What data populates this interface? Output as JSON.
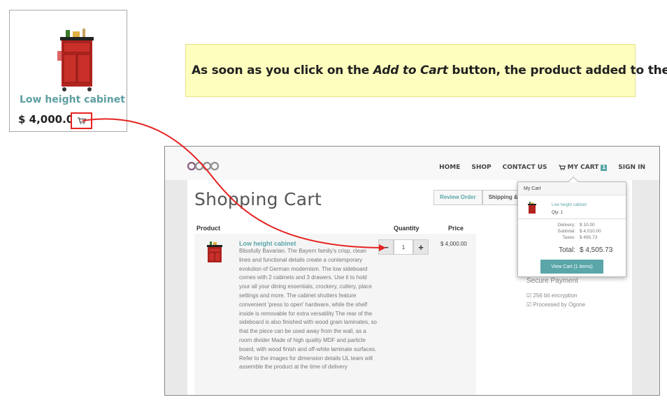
{
  "colors": {
    "accent": "#5aa6a9",
    "annotation_red": "#e52320",
    "callout_bg": "#feffbf"
  },
  "product_card": {
    "name": "Low height cabinet",
    "price": "$ 4,000.00",
    "cart_icon": "cart-icon"
  },
  "callout": {
    "before": "As soon as you click on the ",
    "emphasis": "Add to Cart",
    "after": " button, the product added to the cart"
  },
  "nav": {
    "items": [
      "HOME",
      "SHOP",
      "CONTACT US"
    ],
    "cart_label": "MY CART",
    "cart_count": "1",
    "sign_in": "SIGN IN"
  },
  "page": {
    "title": "Shopping Cart",
    "steps": [
      "Review Order",
      "Shipping &"
    ],
    "columns": {
      "product": "Product",
      "quantity": "Quantity",
      "price": "Price"
    },
    "item": {
      "name": "Low height cabinet",
      "description": "Blissfully Bavarian. The Bayern family's crisp, clean lines and functional details create a contemporary evolution of German modernism. The low sideboard comes with 2 cabinets and 3 drawers. Use it to hold your all your dining essentials, crockery, cutlery, place settings and more. The cabinet shutters feature convenient 'press to open' hardware, while the shelf inside is removable for extra versatility The rear of the sideboard is also finished with wood grain laminates, so that the piece can be used away from the wall, as a room divider Made of high quality MDF and particle board, with wood finish and off-white laminate surfaces. Refer to the images for dimension details UL team will assemble the product at the time of delivery",
      "quantity": "1",
      "price": "$ 4,000.00"
    },
    "secure": {
      "title": "Secure Payment",
      "lines": [
        "☑ 256 bit encryption",
        "☑ Processed by Ogone"
      ]
    }
  },
  "mini_cart": {
    "header": "My Cart",
    "item_name": "Low height cabinet",
    "item_qty": "Qty: 1",
    "delivery_label": "Delivery:",
    "delivery_value": "$ 10.00",
    "subtotal_label": "Subtotal:",
    "subtotal_value": "$ 4,010.00",
    "taxes_label": "Taxes:",
    "taxes_value": "$ 495.73",
    "total_label": "Total:",
    "total_value": "$ 4,505.73",
    "view_cart_button": "View Cart (1 items)"
  }
}
